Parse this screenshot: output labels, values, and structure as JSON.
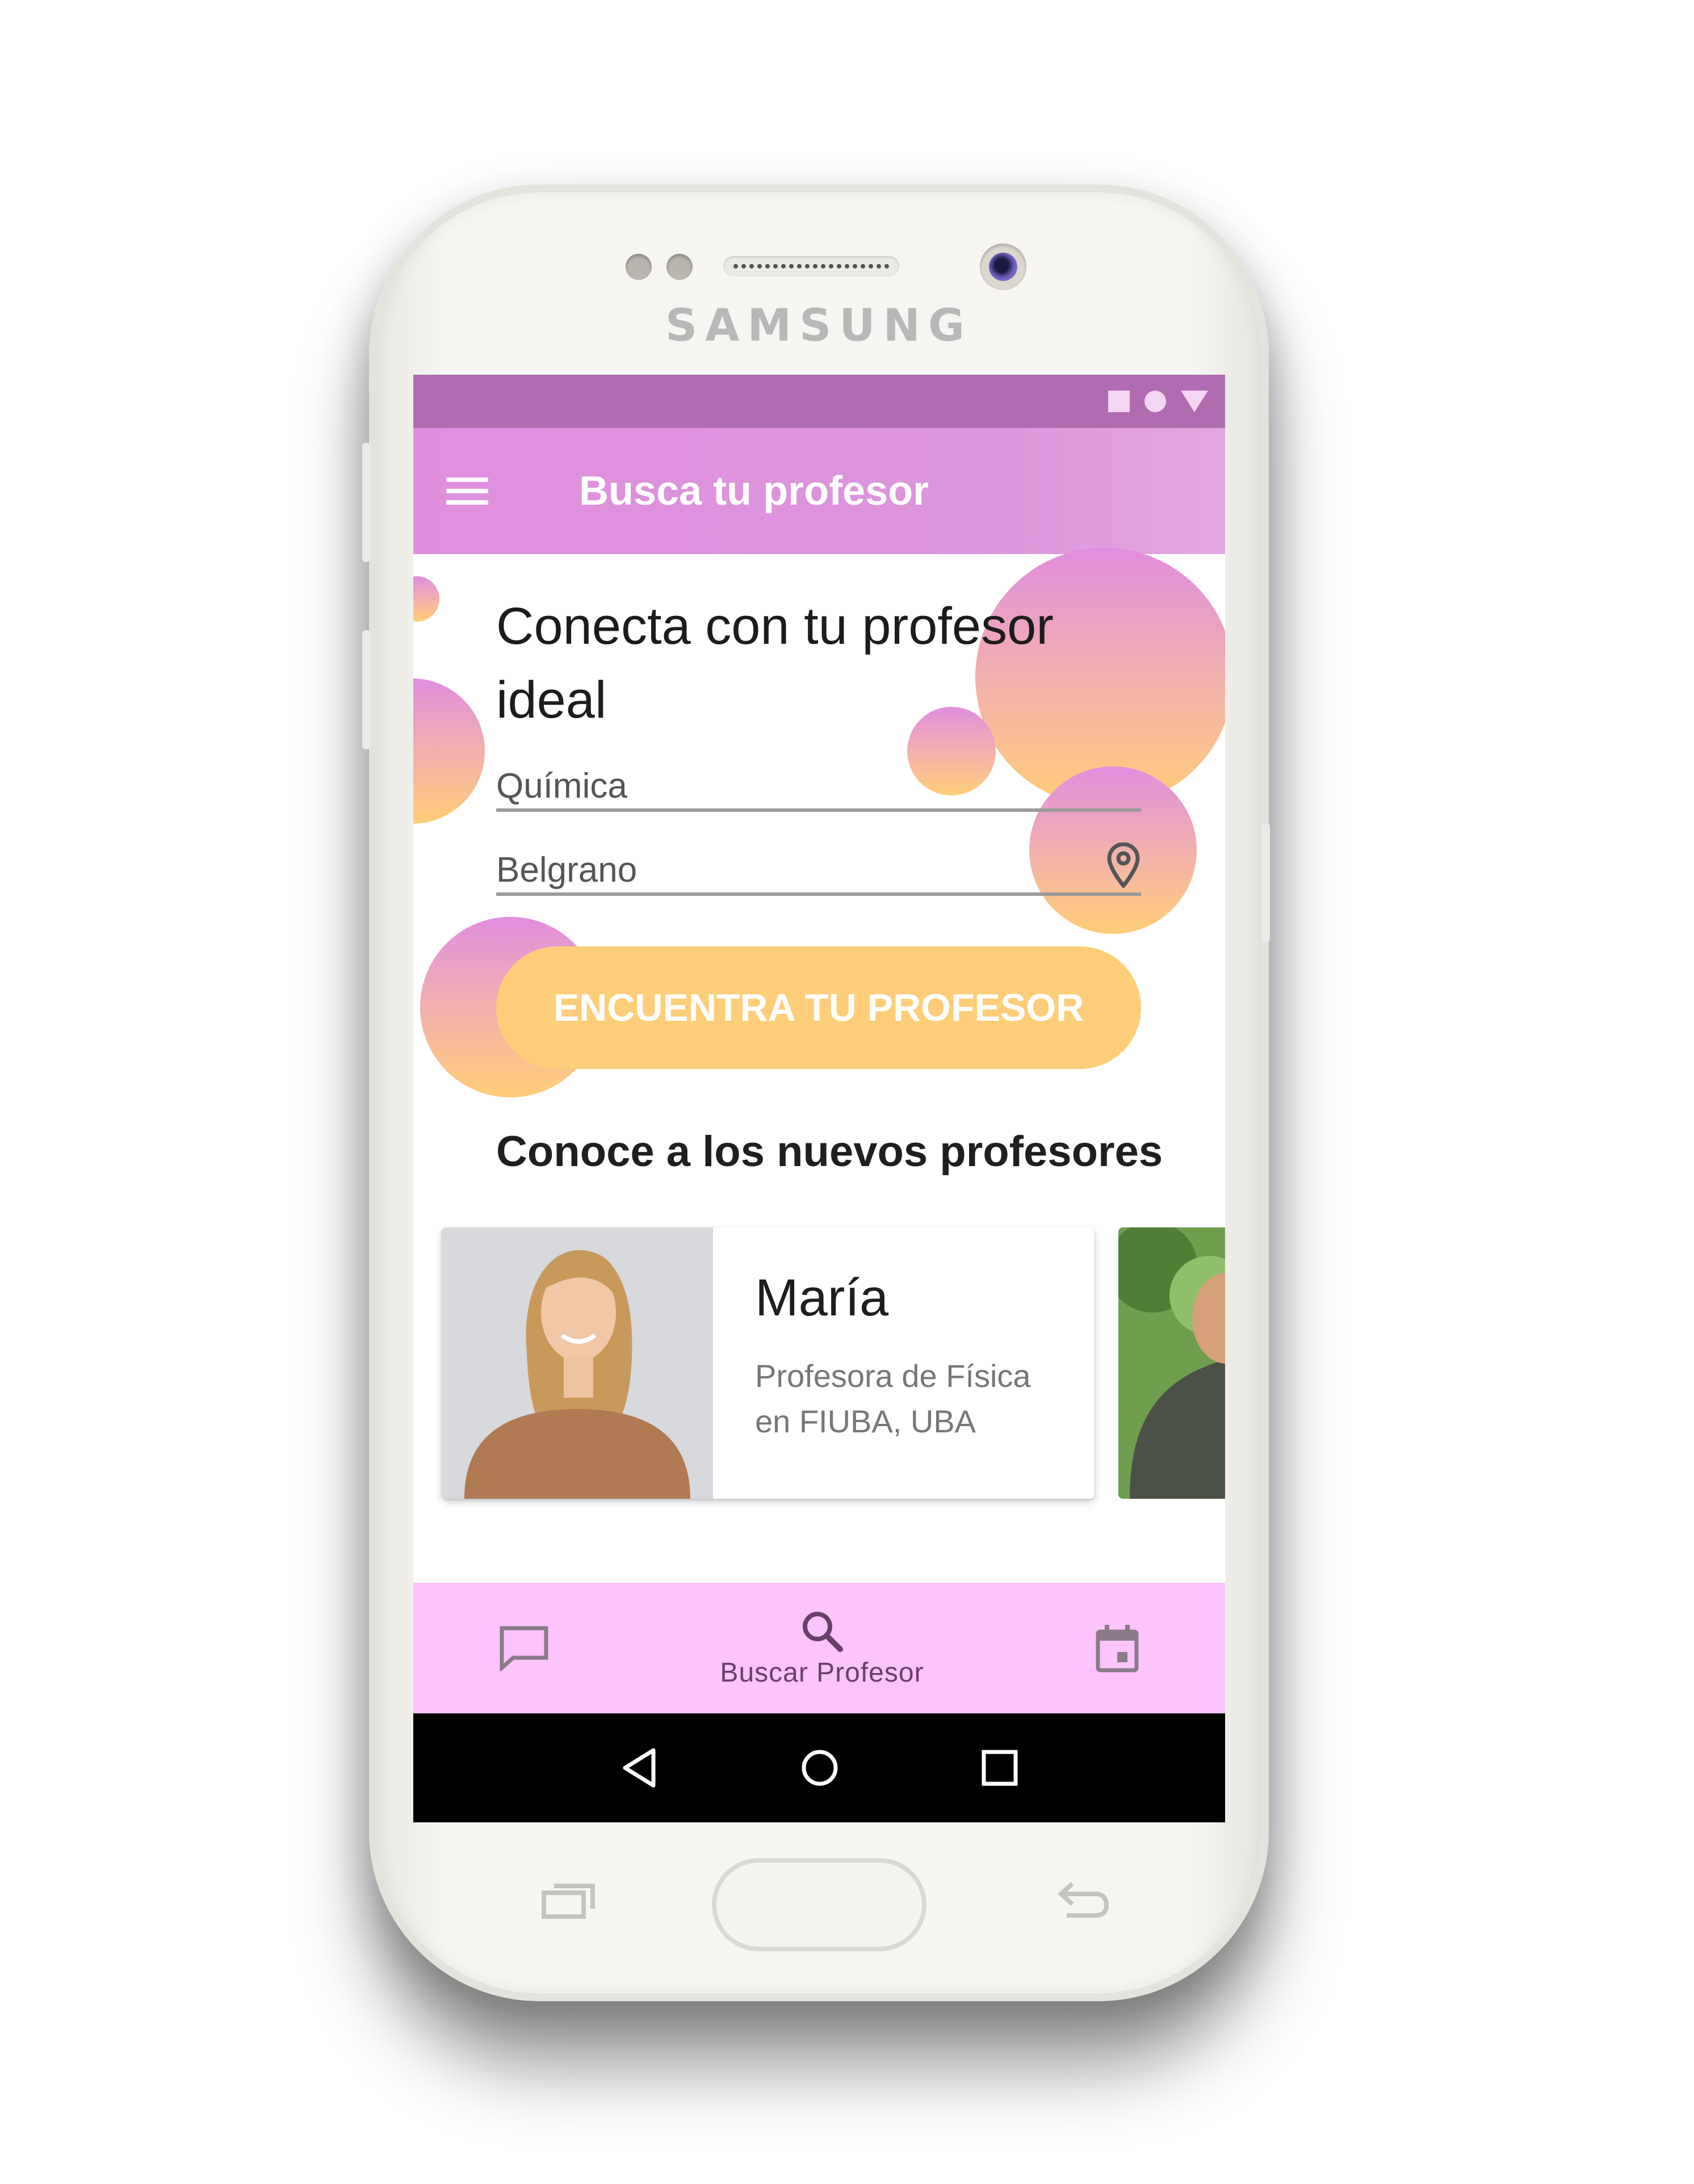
{
  "device": {
    "brand": "SAMSUNG"
  },
  "status_bar": {
    "icons": [
      "square-icon",
      "circle-icon",
      "triangle-icon"
    ]
  },
  "app_bar": {
    "menu_icon": "menu-icon",
    "title": "Busca tu profesor"
  },
  "hero": {
    "headline": "Conecta con tu profesor ideal"
  },
  "search": {
    "subject_value": "Química",
    "location_value": "Belgrano",
    "location_icon": "location-pin-icon",
    "cta_label": "ENCUENTRA TU PROFESOR"
  },
  "new_teachers": {
    "section_title": "Conoce a los nuevos profesores",
    "cards": [
      {
        "name": "María",
        "description": "Profesora de Física en FIUBA, UBA"
      }
    ]
  },
  "bottom_nav": {
    "items": [
      {
        "icon": "chat-icon",
        "label": ""
      },
      {
        "icon": "search-icon",
        "label": "Buscar Profesor"
      },
      {
        "icon": "calendar-icon",
        "label": ""
      }
    ]
  },
  "system_nav": {
    "icons": [
      "back-icon",
      "home-icon",
      "recents-icon"
    ]
  },
  "colors": {
    "status_bar": "#b06cb0",
    "app_bar": "#dc96dc",
    "cta": "#fecd7a",
    "bottom_nav": "#fcc3fc"
  }
}
